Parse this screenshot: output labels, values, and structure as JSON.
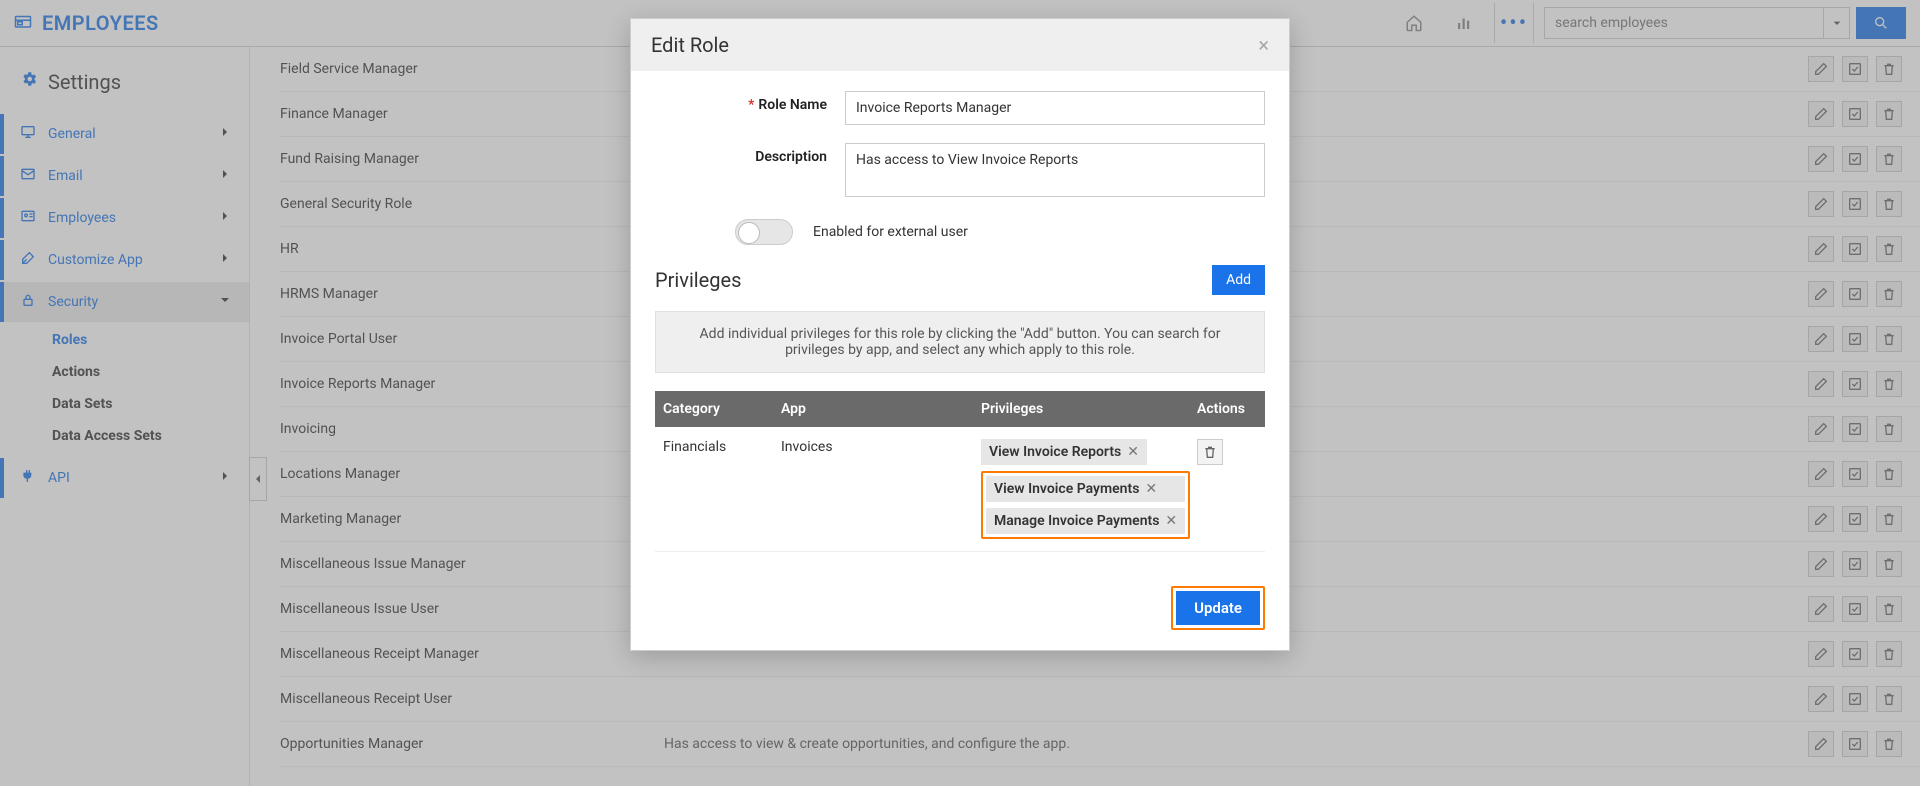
{
  "app": {
    "title": "EMPLOYEES",
    "search_placeholder": "search employees"
  },
  "sidebar": {
    "heading": "Settings",
    "items": [
      {
        "label": "General"
      },
      {
        "label": "Email"
      },
      {
        "label": "Employees"
      },
      {
        "label": "Customize App"
      },
      {
        "label": "Security"
      },
      {
        "label": "API"
      }
    ],
    "security_sub": [
      {
        "label": "Roles"
      },
      {
        "label": "Actions"
      },
      {
        "label": "Data Sets"
      },
      {
        "label": "Data Access Sets"
      }
    ]
  },
  "roles": [
    {
      "name": "Field Service Manager",
      "desc": ""
    },
    {
      "name": "Finance Manager",
      "desc": ""
    },
    {
      "name": "Fund Raising Manager",
      "desc": ""
    },
    {
      "name": "General Security Role",
      "desc": ""
    },
    {
      "name": "HR",
      "desc": ""
    },
    {
      "name": "HRMS Manager",
      "desc": ""
    },
    {
      "name": "Invoice Portal User",
      "desc": ""
    },
    {
      "name": "Invoice Reports Manager",
      "desc": ""
    },
    {
      "name": "Invoicing",
      "desc": ""
    },
    {
      "name": "Locations Manager",
      "desc": ""
    },
    {
      "name": "Marketing Manager",
      "desc": ""
    },
    {
      "name": "Miscellaneous Issue Manager",
      "desc": ""
    },
    {
      "name": "Miscellaneous Issue User",
      "desc": ""
    },
    {
      "name": "Miscellaneous Receipt Manager",
      "desc": ""
    },
    {
      "name": "Miscellaneous Receipt User",
      "desc": ""
    },
    {
      "name": "Opportunities Manager",
      "desc": "Has access to view & create opportunities, and configure the app."
    }
  ],
  "modal": {
    "title": "Edit Role",
    "role_name_label": "Role Name",
    "role_name_value": "Invoice Reports Manager",
    "desc_label": "Description",
    "desc_value": "Has access to View Invoice Reports",
    "toggle_label": "Enabled for external user",
    "privileges_title": "Privileges",
    "add_label": "Add",
    "info_text": "Add individual privileges for this role by clicking the \"Add\" button. You can search for privileges by app, and select any which apply to this role.",
    "table": {
      "headers": {
        "category": "Category",
        "app": "App",
        "privileges": "Privileges",
        "actions": "Actions"
      },
      "row": {
        "category": "Financials",
        "app": "Invoices",
        "chips": [
          "View Invoice Reports",
          "View Invoice Payments",
          "Manage Invoice Payments"
        ]
      }
    },
    "update_label": "Update"
  }
}
